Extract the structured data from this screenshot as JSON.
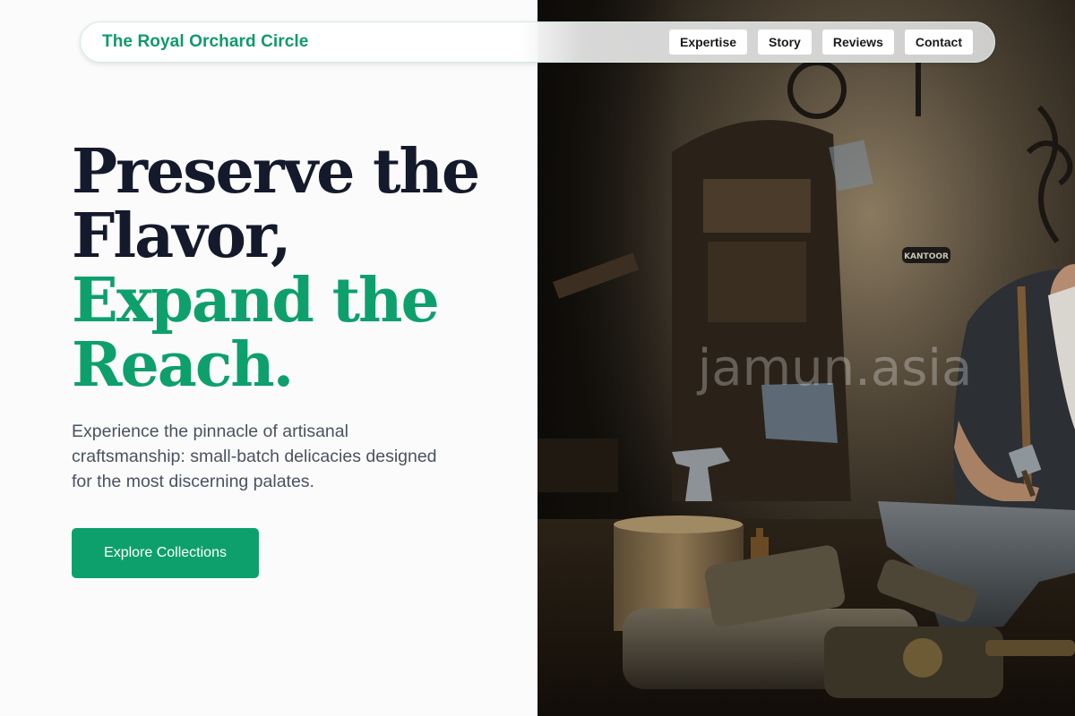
{
  "brand": {
    "name": "The Royal Orchard Circle"
  },
  "nav": {
    "items": [
      {
        "label": "Expertise"
      },
      {
        "label": "Story"
      },
      {
        "label": "Reviews"
      },
      {
        "label": "Contact"
      }
    ]
  },
  "hero": {
    "headline_line1": "Preserve the",
    "headline_line2": "Flavor,",
    "headline_accent_line1": "Expand the",
    "headline_accent_line2": "Reach.",
    "lead": "Experience the pinnacle of artisanal craftsmanship: small-batch delicacies designed for the most discerning palates.",
    "cta_label": "Explore Collections"
  },
  "image": {
    "watermark": "jamun.asia",
    "sign_text": "KANTOOR",
    "subject": "blacksmith-workshop-photo"
  },
  "colors": {
    "accent": "#0ea06c",
    "heading": "#141a2b",
    "body_text": "#4a5260",
    "background": "#fbfbfb"
  }
}
